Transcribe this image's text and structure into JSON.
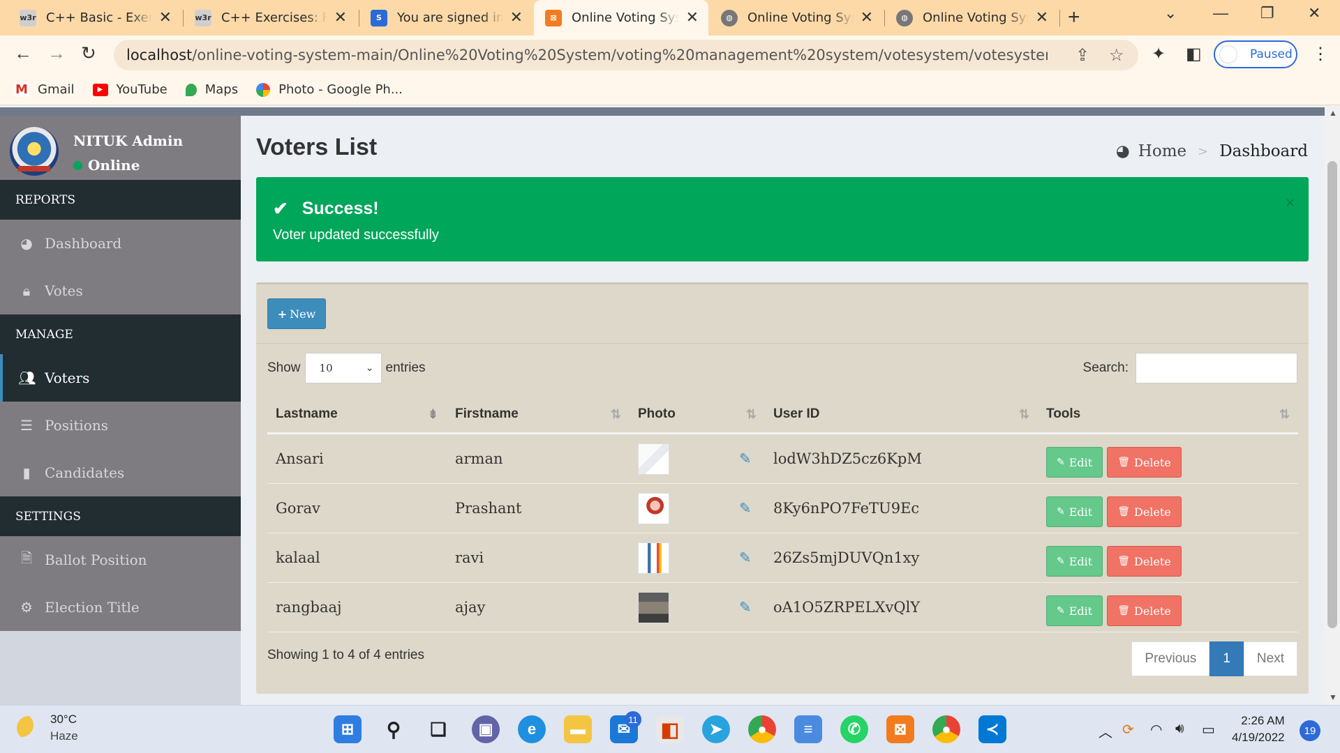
{
  "browser": {
    "tabs": [
      {
        "title": "C++ Basic - Exercis",
        "favicon": "w3r",
        "color": "#cfcfcf"
      },
      {
        "title": "C++ Exercises: Find",
        "favicon": "w3r",
        "color": "#cfcfcf"
      },
      {
        "title": "You are signed in a",
        "favicon": "S",
        "color": "#2d6ad8"
      },
      {
        "title": "Online Voting Syste",
        "favicon": "xampp",
        "color": "#f27b20",
        "active": true
      },
      {
        "title": "Online Voting Syste",
        "favicon": "globe",
        "color": "#666"
      },
      {
        "title": "Online Voting Syste",
        "favicon": "globe",
        "color": "#666"
      }
    ],
    "url_host": "localhost",
    "url_path": "/online-voting-system-main/Online%20Voting%20System/voting%20management%20system/votesystem/votesystem/admin/vote...",
    "profile_label": "Paused",
    "bookmarks": [
      "Gmail",
      "YouTube",
      "Maps",
      "Photo - Google Ph..."
    ]
  },
  "sidebar": {
    "user_name": "NITUK Admin",
    "user_status": "Online",
    "sections": [
      {
        "header": "REPORTS",
        "items": [
          {
            "label": "Dashboard",
            "icon": "dashboard-icon"
          },
          {
            "label": "Votes",
            "icon": "lock-icon"
          }
        ]
      },
      {
        "header": "MANAGE",
        "items": [
          {
            "label": "Voters",
            "icon": "users-icon",
            "active": true
          },
          {
            "label": "Positions",
            "icon": "list-icon"
          },
          {
            "label": "Candidates",
            "icon": "candidate-icon"
          }
        ]
      },
      {
        "header": "SETTINGS",
        "items": [
          {
            "label": "Ballot Position",
            "icon": "file-icon"
          },
          {
            "label": "Election Title",
            "icon": "cogs-icon"
          }
        ]
      }
    ]
  },
  "page": {
    "title": "Voters List",
    "breadcrumb_home": "Home",
    "breadcrumb_current": "Dashboard"
  },
  "alert": {
    "title": "Success!",
    "message": "Voter updated successfully",
    "close": "×"
  },
  "box": {
    "new_label": "New",
    "show_label": "Show",
    "entries_label": "entries",
    "page_length": "10",
    "search_label": "Search:",
    "search_value": "",
    "columns": [
      "Lastname",
      "Firstname",
      "Photo",
      "User ID",
      "Tools"
    ],
    "rows": [
      {
        "lastname": "Ansari",
        "firstname": "arman",
        "user_id": "lodW3hDZ5cz6KpM"
      },
      {
        "lastname": "Gorav",
        "firstname": "Prashant",
        "user_id": "8Ky6nPO7FeTU9Ec"
      },
      {
        "lastname": "kalaal",
        "firstname": "ravi",
        "user_id": "26Zs5mjDUVQn1xy"
      },
      {
        "lastname": "rangbaaj",
        "firstname": "ajay",
        "user_id": "oA1O5ZRPELXvQlY"
      }
    ],
    "edit_label": "Edit",
    "delete_label": "Delete",
    "info": "Showing 1 to 4 of 4 entries",
    "pager": {
      "previous": "Previous",
      "current": "1",
      "next": "Next"
    }
  },
  "taskbar": {
    "temperature": "30°C",
    "weather": "Haze",
    "mail_badge": "11",
    "time": "2:26 AM",
    "date": "4/19/2022",
    "notifications": "19"
  }
}
